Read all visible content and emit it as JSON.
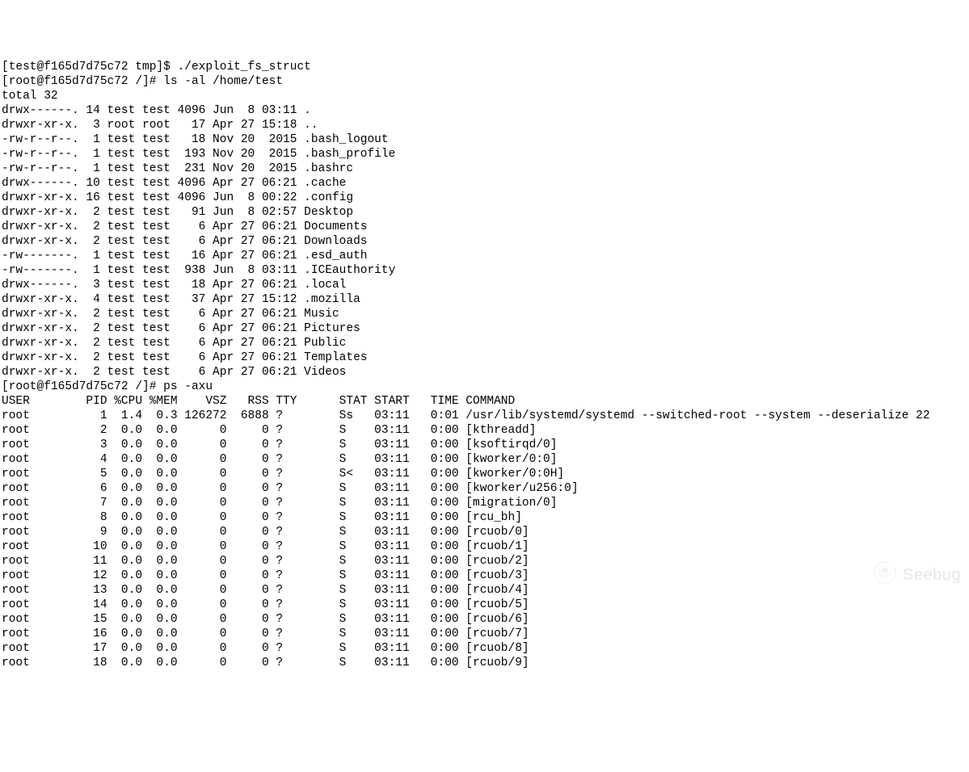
{
  "prompts": {
    "p1_user": "[test@f165d7d75c72 tmp]$ ",
    "p1_cmd": "./exploit_fs_struct",
    "p2_user": "[root@f165d7d75c72 /]# ",
    "p2_cmd": "ls -al /home/test",
    "p3_user": "[root@f165d7d75c72 /]# ",
    "p3_cmd": "ps -axu"
  },
  "ls": {
    "total_line": "total 32",
    "header": "",
    "rows": [
      {
        "perm": "drwx------.",
        "links": "14",
        "owner": "test",
        "group": "test",
        "size": "4096",
        "date": "Jun  8 03:11",
        "name": "."
      },
      {
        "perm": "drwxr-xr-x.",
        "links": " 3",
        "owner": "root",
        "group": "root",
        "size": "  17",
        "date": "Apr 27 15:18",
        "name": ".."
      },
      {
        "perm": "-rw-r--r--.",
        "links": " 1",
        "owner": "test",
        "group": "test",
        "size": "  18",
        "date": "Nov 20  2015",
        "name": ".bash_logout"
      },
      {
        "perm": "-rw-r--r--.",
        "links": " 1",
        "owner": "test",
        "group": "test",
        "size": " 193",
        "date": "Nov 20  2015",
        "name": ".bash_profile"
      },
      {
        "perm": "-rw-r--r--.",
        "links": " 1",
        "owner": "test",
        "group": "test",
        "size": " 231",
        "date": "Nov 20  2015",
        "name": ".bashrc"
      },
      {
        "perm": "drwx------.",
        "links": "10",
        "owner": "test",
        "group": "test",
        "size": "4096",
        "date": "Apr 27 06:21",
        "name": ".cache"
      },
      {
        "perm": "drwxr-xr-x.",
        "links": "16",
        "owner": "test",
        "group": "test",
        "size": "4096",
        "date": "Jun  8 00:22",
        "name": ".config"
      },
      {
        "perm": "drwxr-xr-x.",
        "links": " 2",
        "owner": "test",
        "group": "test",
        "size": "  91",
        "date": "Jun  8 02:57",
        "name": "Desktop"
      },
      {
        "perm": "drwxr-xr-x.",
        "links": " 2",
        "owner": "test",
        "group": "test",
        "size": "   6",
        "date": "Apr 27 06:21",
        "name": "Documents"
      },
      {
        "perm": "drwxr-xr-x.",
        "links": " 2",
        "owner": "test",
        "group": "test",
        "size": "   6",
        "date": "Apr 27 06:21",
        "name": "Downloads"
      },
      {
        "perm": "-rw-------.",
        "links": " 1",
        "owner": "test",
        "group": "test",
        "size": "  16",
        "date": "Apr 27 06:21",
        "name": ".esd_auth"
      },
      {
        "perm": "-rw-------.",
        "links": " 1",
        "owner": "test",
        "group": "test",
        "size": " 938",
        "date": "Jun  8 03:11",
        "name": ".ICEauthority"
      },
      {
        "perm": "drwx------.",
        "links": " 3",
        "owner": "test",
        "group": "test",
        "size": "  18",
        "date": "Apr 27 06:21",
        "name": ".local"
      },
      {
        "perm": "drwxr-xr-x.",
        "links": " 4",
        "owner": "test",
        "group": "test",
        "size": "  37",
        "date": "Apr 27 15:12",
        "name": ".mozilla"
      },
      {
        "perm": "drwxr-xr-x.",
        "links": " 2",
        "owner": "test",
        "group": "test",
        "size": "   6",
        "date": "Apr 27 06:21",
        "name": "Music"
      },
      {
        "perm": "drwxr-xr-x.",
        "links": " 2",
        "owner": "test",
        "group": "test",
        "size": "   6",
        "date": "Apr 27 06:21",
        "name": "Pictures"
      },
      {
        "perm": "drwxr-xr-x.",
        "links": " 2",
        "owner": "test",
        "group": "test",
        "size": "   6",
        "date": "Apr 27 06:21",
        "name": "Public"
      },
      {
        "perm": "drwxr-xr-x.",
        "links": " 2",
        "owner": "test",
        "group": "test",
        "size": "   6",
        "date": "Apr 27 06:21",
        "name": "Templates"
      },
      {
        "perm": "drwxr-xr-x.",
        "links": " 2",
        "owner": "test",
        "group": "test",
        "size": "   6",
        "date": "Apr 27 06:21",
        "name": "Videos"
      }
    ]
  },
  "ps": {
    "header": {
      "user": "USER",
      "pid": "PID",
      "cpu": "%CPU",
      "mem": "%MEM",
      "vsz": "VSZ",
      "rss": "RSS",
      "tty": "TTY",
      "stat": "STAT",
      "start": "START",
      "time": "TIME",
      "command": "COMMAND"
    },
    "rows": [
      {
        "user": "root",
        "pid": "1",
        "cpu": "1.4",
        "mem": "0.3",
        "vsz": "126272",
        "rss": "6888",
        "tty": "?",
        "stat": "Ss",
        "start": "03:11",
        "time": "0:01",
        "command": "/usr/lib/systemd/systemd --switched-root --system --deserialize 22"
      },
      {
        "user": "root",
        "pid": "2",
        "cpu": "0.0",
        "mem": "0.0",
        "vsz": "0",
        "rss": "0",
        "tty": "?",
        "stat": "S",
        "start": "03:11",
        "time": "0:00",
        "command": "[kthreadd]"
      },
      {
        "user": "root",
        "pid": "3",
        "cpu": "0.0",
        "mem": "0.0",
        "vsz": "0",
        "rss": "0",
        "tty": "?",
        "stat": "S",
        "start": "03:11",
        "time": "0:00",
        "command": "[ksoftirqd/0]"
      },
      {
        "user": "root",
        "pid": "4",
        "cpu": "0.0",
        "mem": "0.0",
        "vsz": "0",
        "rss": "0",
        "tty": "?",
        "stat": "S",
        "start": "03:11",
        "time": "0:00",
        "command": "[kworker/0:0]"
      },
      {
        "user": "root",
        "pid": "5",
        "cpu": "0.0",
        "mem": "0.0",
        "vsz": "0",
        "rss": "0",
        "tty": "?",
        "stat": "S<",
        "start": "03:11",
        "time": "0:00",
        "command": "[kworker/0:0H]"
      },
      {
        "user": "root",
        "pid": "6",
        "cpu": "0.0",
        "mem": "0.0",
        "vsz": "0",
        "rss": "0",
        "tty": "?",
        "stat": "S",
        "start": "03:11",
        "time": "0:00",
        "command": "[kworker/u256:0]"
      },
      {
        "user": "root",
        "pid": "7",
        "cpu": "0.0",
        "mem": "0.0",
        "vsz": "0",
        "rss": "0",
        "tty": "?",
        "stat": "S",
        "start": "03:11",
        "time": "0:00",
        "command": "[migration/0]"
      },
      {
        "user": "root",
        "pid": "8",
        "cpu": "0.0",
        "mem": "0.0",
        "vsz": "0",
        "rss": "0",
        "tty": "?",
        "stat": "S",
        "start": "03:11",
        "time": "0:00",
        "command": "[rcu_bh]"
      },
      {
        "user": "root",
        "pid": "9",
        "cpu": "0.0",
        "mem": "0.0",
        "vsz": "0",
        "rss": "0",
        "tty": "?",
        "stat": "S",
        "start": "03:11",
        "time": "0:00",
        "command": "[rcuob/0]"
      },
      {
        "user": "root",
        "pid": "10",
        "cpu": "0.0",
        "mem": "0.0",
        "vsz": "0",
        "rss": "0",
        "tty": "?",
        "stat": "S",
        "start": "03:11",
        "time": "0:00",
        "command": "[rcuob/1]"
      },
      {
        "user": "root",
        "pid": "11",
        "cpu": "0.0",
        "mem": "0.0",
        "vsz": "0",
        "rss": "0",
        "tty": "?",
        "stat": "S",
        "start": "03:11",
        "time": "0:00",
        "command": "[rcuob/2]"
      },
      {
        "user": "root",
        "pid": "12",
        "cpu": "0.0",
        "mem": "0.0",
        "vsz": "0",
        "rss": "0",
        "tty": "?",
        "stat": "S",
        "start": "03:11",
        "time": "0:00",
        "command": "[rcuob/3]"
      },
      {
        "user": "root",
        "pid": "13",
        "cpu": "0.0",
        "mem": "0.0",
        "vsz": "0",
        "rss": "0",
        "tty": "?",
        "stat": "S",
        "start": "03:11",
        "time": "0:00",
        "command": "[rcuob/4]"
      },
      {
        "user": "root",
        "pid": "14",
        "cpu": "0.0",
        "mem": "0.0",
        "vsz": "0",
        "rss": "0",
        "tty": "?",
        "stat": "S",
        "start": "03:11",
        "time": "0:00",
        "command": "[rcuob/5]"
      },
      {
        "user": "root",
        "pid": "15",
        "cpu": "0.0",
        "mem": "0.0",
        "vsz": "0",
        "rss": "0",
        "tty": "?",
        "stat": "S",
        "start": "03:11",
        "time": "0:00",
        "command": "[rcuob/6]"
      },
      {
        "user": "root",
        "pid": "16",
        "cpu": "0.0",
        "mem": "0.0",
        "vsz": "0",
        "rss": "0",
        "tty": "?",
        "stat": "S",
        "start": "03:11",
        "time": "0:00",
        "command": "[rcuob/7]"
      },
      {
        "user": "root",
        "pid": "17",
        "cpu": "0.0",
        "mem": "0.0",
        "vsz": "0",
        "rss": "0",
        "tty": "?",
        "stat": "S",
        "start": "03:11",
        "time": "0:00",
        "command": "[rcuob/8]"
      },
      {
        "user": "root",
        "pid": "18",
        "cpu": "0.0",
        "mem": "0.0",
        "vsz": "0",
        "rss": "0",
        "tty": "?",
        "stat": "S",
        "start": "03:11",
        "time": "0:00",
        "command": "[rcuob/9]"
      }
    ]
  },
  "watermark_text": "Seebug"
}
